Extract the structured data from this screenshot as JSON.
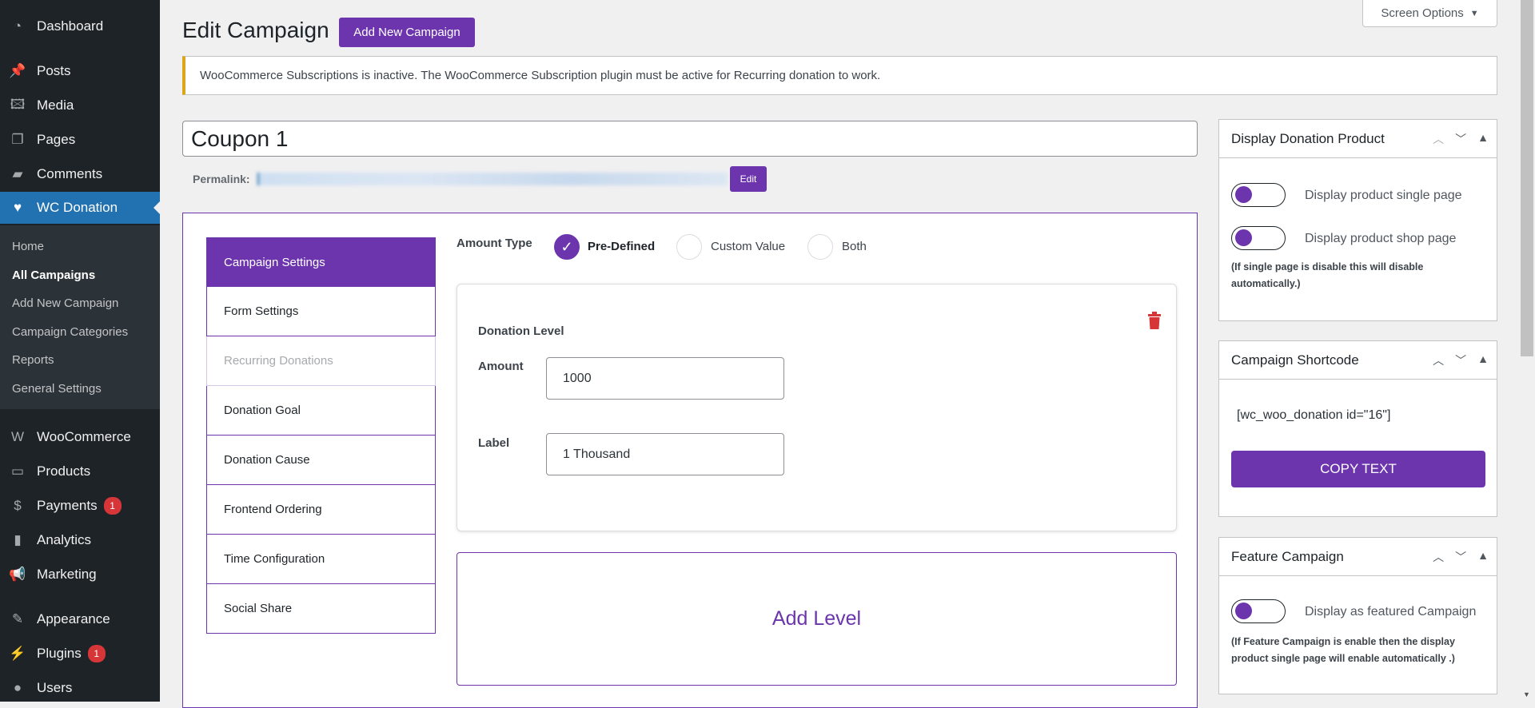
{
  "sidebar": {
    "items": [
      {
        "label": "Dashboard",
        "icon": "dashboard-icon"
      },
      {
        "label": "Posts",
        "icon": "pin-icon"
      },
      {
        "label": "Media",
        "icon": "media-icon"
      },
      {
        "label": "Pages",
        "icon": "pages-icon"
      },
      {
        "label": "Comments",
        "icon": "comment-icon"
      },
      {
        "label": "WC Donation",
        "icon": "heart-icon"
      },
      {
        "label": "WooCommerce",
        "icon": "woo-icon"
      },
      {
        "label": "Products",
        "icon": "archive-icon"
      },
      {
        "label": "Payments",
        "icon": "dollar-icon",
        "badge": "1"
      },
      {
        "label": "Analytics",
        "icon": "chart-bar-icon"
      },
      {
        "label": "Marketing",
        "icon": "megaphone-icon"
      },
      {
        "label": "Appearance",
        "icon": "brush-icon"
      },
      {
        "label": "Plugins",
        "icon": "plugin-icon",
        "badge": "1"
      },
      {
        "label": "Users",
        "icon": "user-icon"
      }
    ],
    "submenu": [
      "Home",
      "All Campaigns",
      "Add New Campaign",
      "Campaign Categories",
      "Reports",
      "General Settings"
    ]
  },
  "header": {
    "title": "Edit Campaign",
    "add_new": "Add New Campaign",
    "screen_options": "Screen Options"
  },
  "notice": "WooCommerce Subscriptions is inactive. The WooCommerce Subscription plugin must be active for Recurring donation to work.",
  "post": {
    "title": "Coupon 1",
    "permalink_label": "Permalink:",
    "edit": "Edit"
  },
  "tabs": [
    "Campaign Settings",
    "Form Settings",
    "Recurring Donations",
    "Donation Goal",
    "Donation Cause",
    "Frontend Ordering",
    "Time Configuration",
    "Social Share"
  ],
  "amount_type": {
    "label": "Amount Type",
    "options": [
      "Pre-Defined",
      "Custom Value",
      "Both"
    ],
    "selected": "Pre-Defined"
  },
  "level": {
    "title": "Donation Level",
    "amount_label": "Amount",
    "amount": "1000",
    "label_label": "Label",
    "label": "1 Thousand"
  },
  "add_level": "Add Level",
  "boxes": {
    "display": {
      "title": "Display Donation Product",
      "single": "Display product single page",
      "shop": "Display product shop page",
      "note": "(If single page is disable this will disable automatically.)"
    },
    "shortcode": {
      "title": "Campaign Shortcode",
      "code": "[wc_woo_donation id=\"16\"]",
      "copy": "COPY TEXT"
    },
    "feature": {
      "title": "Feature Campaign",
      "toggle": "Display as featured Campaign",
      "note": "(If Feature Campaign is enable then the display product single page will enable automatically .)"
    }
  },
  "colors": {
    "accent": "#6c35ad",
    "wp_blue": "#2271b1",
    "danger": "#d63638"
  }
}
